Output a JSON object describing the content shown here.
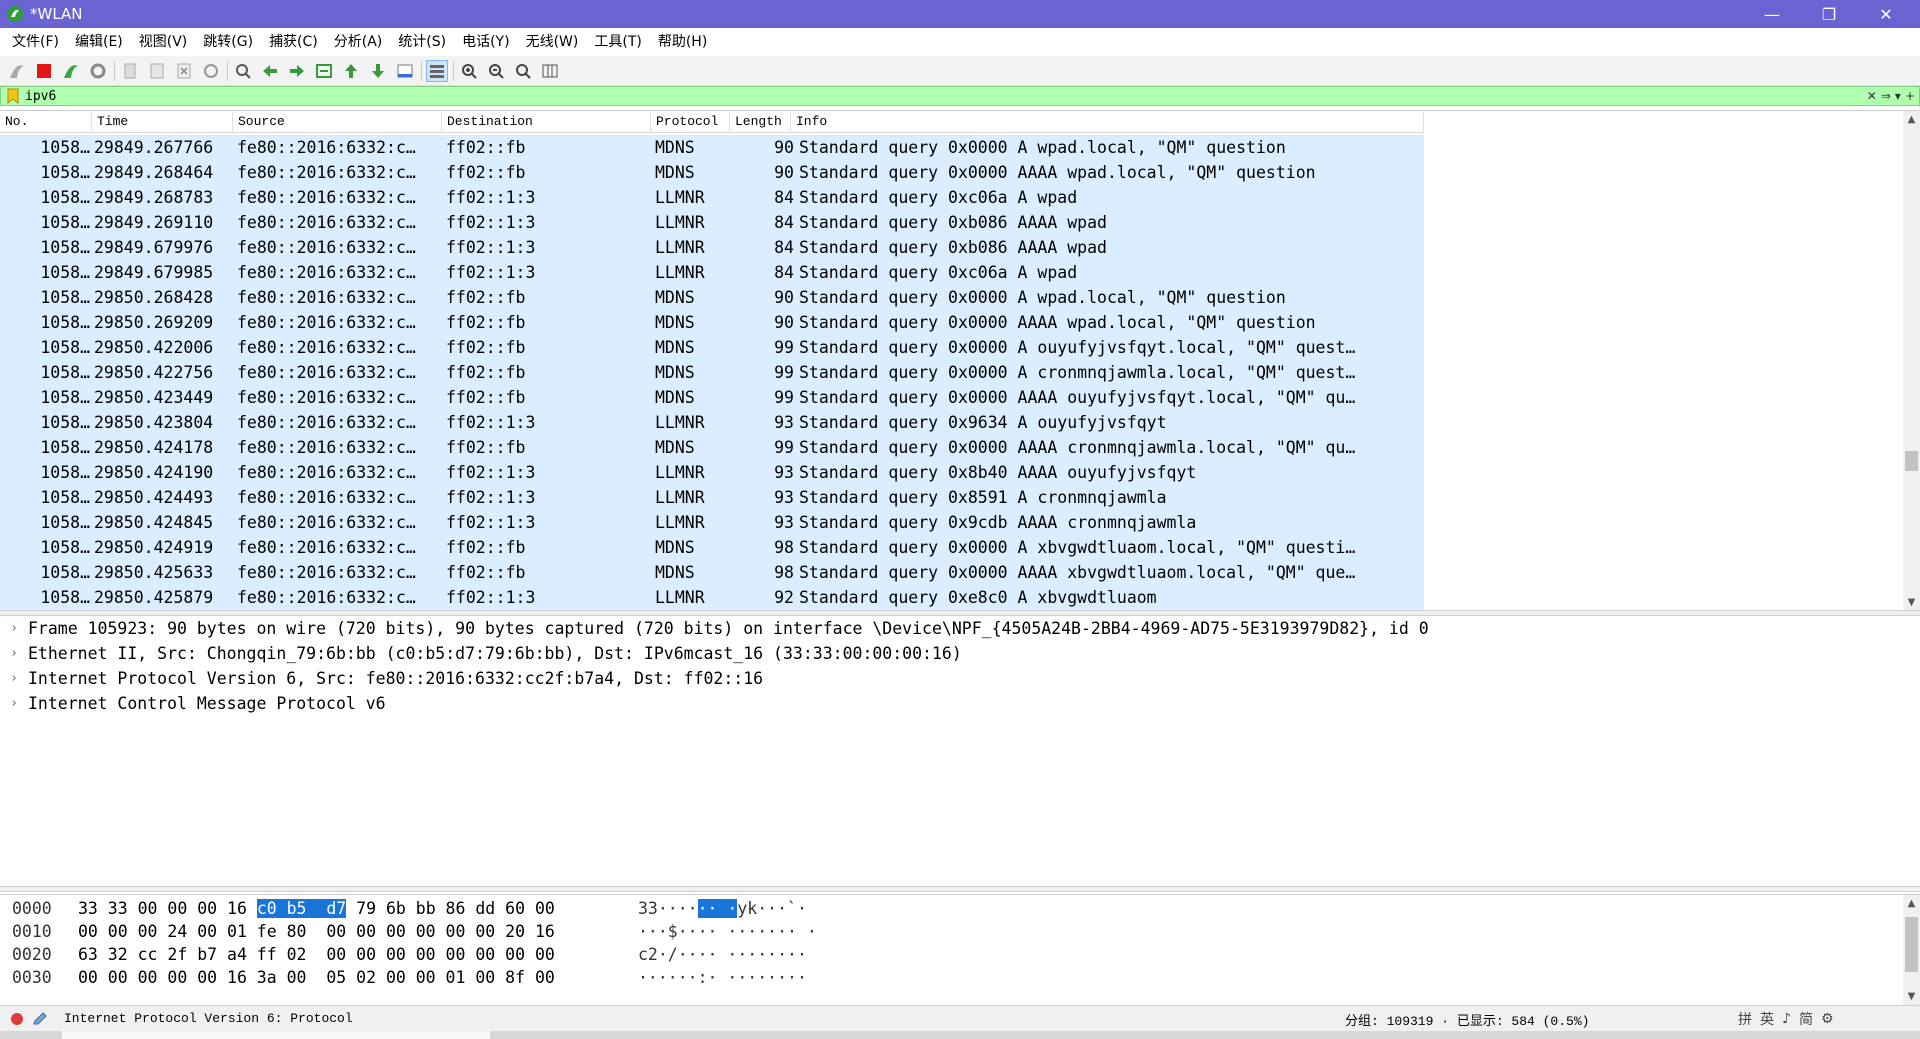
{
  "window": {
    "title": "*WLAN",
    "minimize": "—",
    "restore": "❐",
    "close": "✕"
  },
  "menu": [
    {
      "label": "文件(F)"
    },
    {
      "label": "编辑(E)"
    },
    {
      "label": "视图(V)"
    },
    {
      "label": "跳转(G)"
    },
    {
      "label": "捕获(C)"
    },
    {
      "label": "分析(A)"
    },
    {
      "label": "统计(S)"
    },
    {
      "label": "电话(Y)"
    },
    {
      "label": "无线(W)"
    },
    {
      "label": "工具(T)"
    },
    {
      "label": "帮助(H)"
    }
  ],
  "filter": {
    "value": "ipv6",
    "clear_glyph": "✕",
    "apply_glyph": "⇒",
    "dropdown_glyph": "▾",
    "add_glyph": "+"
  },
  "colors": {
    "titlebar": "#6b63d1",
    "filter_bg": "#afffaf",
    "row_bg": "#dbeeff",
    "highlight": "#1a75d9"
  },
  "packet_list": {
    "columns": [
      "No.",
      "Time",
      "Source",
      "Destination",
      "Protocol",
      "Length",
      "Info"
    ],
    "rows": [
      {
        "no": "1058…",
        "time": "29849.267766",
        "src": "fe80::2016:6332:c…",
        "dst": "ff02::fb",
        "proto": "MDNS",
        "len": "90",
        "info": "Standard query 0x0000 A wpad.local, \"QM\" question"
      },
      {
        "no": "1058…",
        "time": "29849.268464",
        "src": "fe80::2016:6332:c…",
        "dst": "ff02::fb",
        "proto": "MDNS",
        "len": "90",
        "info": "Standard query 0x0000 AAAA wpad.local, \"QM\" question"
      },
      {
        "no": "1058…",
        "time": "29849.268783",
        "src": "fe80::2016:6332:c…",
        "dst": "ff02::1:3",
        "proto": "LLMNR",
        "len": "84",
        "info": "Standard query 0xc06a A wpad"
      },
      {
        "no": "1058…",
        "time": "29849.269110",
        "src": "fe80::2016:6332:c…",
        "dst": "ff02::1:3",
        "proto": "LLMNR",
        "len": "84",
        "info": "Standard query 0xb086 AAAA wpad"
      },
      {
        "no": "1058…",
        "time": "29849.679976",
        "src": "fe80::2016:6332:c…",
        "dst": "ff02::1:3",
        "proto": "LLMNR",
        "len": "84",
        "info": "Standard query 0xb086 AAAA wpad"
      },
      {
        "no": "1058…",
        "time": "29849.679985",
        "src": "fe80::2016:6332:c…",
        "dst": "ff02::1:3",
        "proto": "LLMNR",
        "len": "84",
        "info": "Standard query 0xc06a A wpad"
      },
      {
        "no": "1058…",
        "time": "29850.268428",
        "src": "fe80::2016:6332:c…",
        "dst": "ff02::fb",
        "proto": "MDNS",
        "len": "90",
        "info": "Standard query 0x0000 A wpad.local, \"QM\" question"
      },
      {
        "no": "1058…",
        "time": "29850.269209",
        "src": "fe80::2016:6332:c…",
        "dst": "ff02::fb",
        "proto": "MDNS",
        "len": "90",
        "info": "Standard query 0x0000 AAAA wpad.local, \"QM\" question"
      },
      {
        "no": "1058…",
        "time": "29850.422006",
        "src": "fe80::2016:6332:c…",
        "dst": "ff02::fb",
        "proto": "MDNS",
        "len": "99",
        "info": "Standard query 0x0000 A ouyufyjvsfqyt.local, \"QM\" quest…"
      },
      {
        "no": "1058…",
        "time": "29850.422756",
        "src": "fe80::2016:6332:c…",
        "dst": "ff02::fb",
        "proto": "MDNS",
        "len": "99",
        "info": "Standard query 0x0000 A cronmnqjawmla.local, \"QM\" quest…"
      },
      {
        "no": "1058…",
        "time": "29850.423449",
        "src": "fe80::2016:6332:c…",
        "dst": "ff02::fb",
        "proto": "MDNS",
        "len": "99",
        "info": "Standard query 0x0000 AAAA ouyufyjvsfqyt.local, \"QM\" qu…"
      },
      {
        "no": "1058…",
        "time": "29850.423804",
        "src": "fe80::2016:6332:c…",
        "dst": "ff02::1:3",
        "proto": "LLMNR",
        "len": "93",
        "info": "Standard query 0x9634 A ouyufyjvsfqyt"
      },
      {
        "no": "1058…",
        "time": "29850.424178",
        "src": "fe80::2016:6332:c…",
        "dst": "ff02::fb",
        "proto": "MDNS",
        "len": "99",
        "info": "Standard query 0x0000 AAAA cronmnqjawmla.local, \"QM\" qu…"
      },
      {
        "no": "1058…",
        "time": "29850.424190",
        "src": "fe80::2016:6332:c…",
        "dst": "ff02::1:3",
        "proto": "LLMNR",
        "len": "93",
        "info": "Standard query 0x8b40 AAAA ouyufyjvsfqyt"
      },
      {
        "no": "1058…",
        "time": "29850.424493",
        "src": "fe80::2016:6332:c…",
        "dst": "ff02::1:3",
        "proto": "LLMNR",
        "len": "93",
        "info": "Standard query 0x8591 A cronmnqjawmla"
      },
      {
        "no": "1058…",
        "time": "29850.424845",
        "src": "fe80::2016:6332:c…",
        "dst": "ff02::1:3",
        "proto": "LLMNR",
        "len": "93",
        "info": "Standard query 0x9cdb AAAA cronmnqjawmla"
      },
      {
        "no": "1058…",
        "time": "29850.424919",
        "src": "fe80::2016:6332:c…",
        "dst": "ff02::fb",
        "proto": "MDNS",
        "len": "98",
        "info": "Standard query 0x0000 A xbvgwdtluaom.local, \"QM\" questi…"
      },
      {
        "no": "1058…",
        "time": "29850.425633",
        "src": "fe80::2016:6332:c…",
        "dst": "ff02::fb",
        "proto": "MDNS",
        "len": "98",
        "info": "Standard query 0x0000 AAAA xbvgwdtluaom.local, \"QM\" que…"
      },
      {
        "no": "1058…",
        "time": "29850.425879",
        "src": "fe80::2016:6332:c…",
        "dst": "ff02::1:3",
        "proto": "LLMNR",
        "len": "92",
        "info": "Standard query 0xe8c0 A xbvgwdtluaom"
      }
    ]
  },
  "details": [
    {
      "text": "Frame 105923: 90 bytes on wire (720 bits), 90 bytes captured (720 bits) on interface \\Device\\NPF_{4505A24B-2BB4-4969-AD75-5E3193979D82}, id 0"
    },
    {
      "text": "Ethernet II, Src: Chongqin_79:6b:bb (c0:b5:d7:79:6b:bb), Dst: IPv6mcast_16 (33:33:00:00:00:16)"
    },
    {
      "text": "Internet Protocol Version 6, Src: fe80::2016:6332:cc2f:b7a4, Dst: ff02::16"
    },
    {
      "text": "Internet Control Message Protocol v6"
    }
  ],
  "bytes": [
    {
      "offset": "0000",
      "hex_pre": "33 33 00 00 00 16 ",
      "hex_hl": "c0 b5  d7",
      "hex_post": " 79 6b bb 86 dd 60 00",
      "asc_pre": "33····",
      "asc_hl": "·· ·",
      "asc_post": "yk···`·"
    },
    {
      "offset": "0010",
      "hex_pre": "00 00 00 24 00 01 fe 80  00 00 00 00 00 00 20 16",
      "hex_hl": "",
      "hex_post": "",
      "asc_pre": "···$···· ······· ·",
      "asc_hl": "",
      "asc_post": ""
    },
    {
      "offset": "0020",
      "hex_pre": "63 32 cc 2f b7 a4 ff 02  00 00 00 00 00 00 00 00",
      "hex_hl": "",
      "hex_post": "",
      "asc_pre": "c2·/···· ········",
      "asc_hl": "",
      "asc_post": ""
    },
    {
      "offset": "0030",
      "hex_pre": "00 00 00 00 00 16 3a 00  05 02 00 00 01 00 8f 00",
      "hex_hl": "",
      "hex_post": "",
      "asc_pre": "······:· ········",
      "asc_hl": "",
      "asc_post": ""
    }
  ],
  "status": {
    "text": "Internet Protocol Version 6: Protocol",
    "packets": "分组: 109319 · 已显示: 584 (0.5%)",
    "ime": [
      "拼",
      "英",
      "♪",
      "简",
      "⚙"
    ]
  }
}
